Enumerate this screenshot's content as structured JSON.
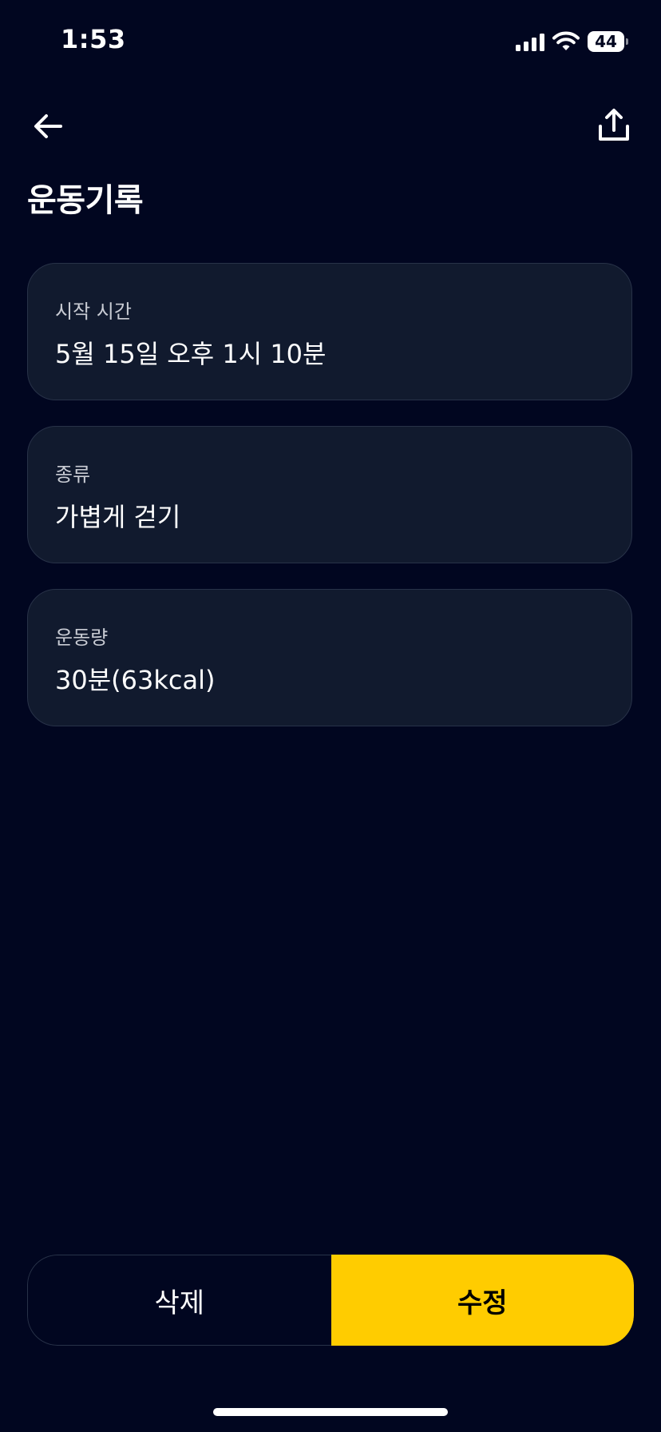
{
  "status_bar": {
    "time": "1:53",
    "battery_level": "44",
    "icons": [
      "signal-icon",
      "wifi-icon",
      "battery-icon"
    ]
  },
  "header": {
    "back_icon": "arrow-left-icon",
    "share_icon": "share-upload-icon",
    "title": "운동기록"
  },
  "fields": [
    {
      "label": "시작 시간",
      "value": "5월 15일 오후 1시 10분"
    },
    {
      "label": "종류",
      "value": "가볍게 걷기"
    },
    {
      "label": "운동량",
      "value": "30분(63kcal)"
    }
  ],
  "actions": {
    "delete_label": "삭제",
    "edit_label": "수정"
  },
  "colors": {
    "background": "#010620",
    "card_background": "#111a2e",
    "card_border": "#283248",
    "accent": "#ffcc00"
  }
}
